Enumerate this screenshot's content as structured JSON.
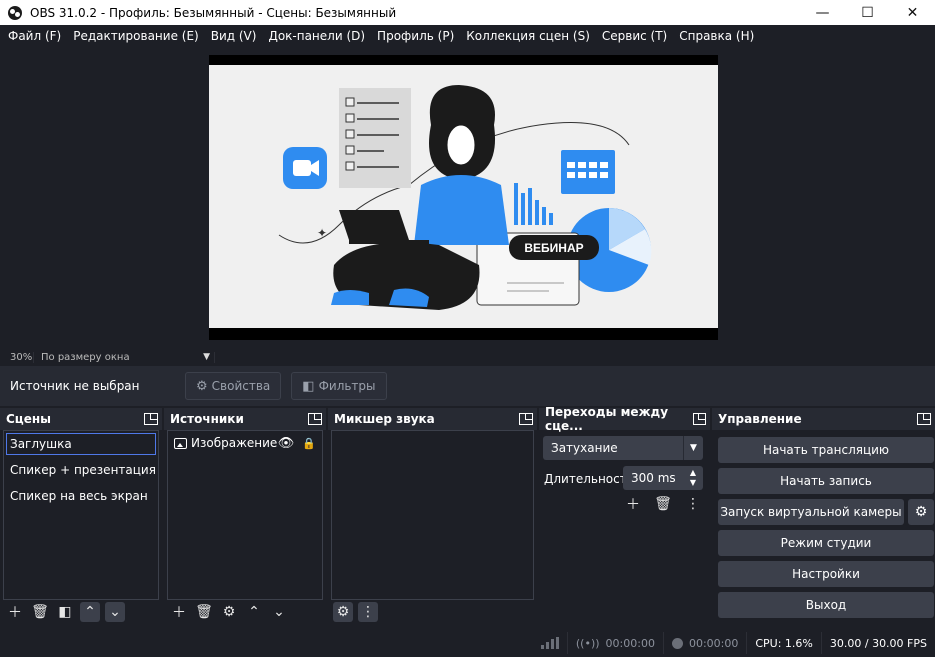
{
  "window": {
    "title": "OBS 31.0.2 - Профиль: Безымянный - Сцены: Безымянный",
    "minimize": "—",
    "maximize": "☐",
    "close": "✕"
  },
  "menu": [
    "Файл (F)",
    "Редактирование (E)",
    "Вид (V)",
    "Док-панели (D)",
    "Профиль (P)",
    "Коллекция сцен (S)",
    "Сервис (T)",
    "Справка (H)"
  ],
  "preview": {
    "zoom": "30%",
    "scale_mode": "По размеру окна",
    "slide_badge": "ВЕБИНАР"
  },
  "source_toolbar": {
    "no_source": "Источник не выбран",
    "properties": "Свойства",
    "filters": "Фильтры"
  },
  "scenes": {
    "title": "Сцены",
    "items": [
      "Заглушка",
      "Спикер + презентация",
      "Спикер на весь экран"
    ],
    "selected_index": 0
  },
  "sources": {
    "title": "Источники",
    "items": [
      {
        "name": "Изображение",
        "icon": "image-icon",
        "visible": true,
        "locked": true
      }
    ]
  },
  "mixer": {
    "title": "Микшер звука"
  },
  "transitions": {
    "title": "Переходы между сце...",
    "selected": "Затухание",
    "duration_label": "Длительность",
    "duration_value": "300 ms"
  },
  "controls": {
    "title": "Управление",
    "start_stream": "Начать трансляцию",
    "start_record": "Начать запись",
    "virtual_camera": "Запуск виртуальной камеры",
    "studio_mode": "Режим студии",
    "settings": "Настройки",
    "exit": "Выход"
  },
  "status": {
    "stream_time": "00:00:00",
    "record_time": "00:00:00",
    "cpu": "CPU: 1.6%",
    "fps": "30.00 / 30.00 FPS"
  },
  "colors": {
    "background": "#1d1f26",
    "panel": "#272a33",
    "button": "#3c404b",
    "selection": "#4f78e8",
    "illustration_blue": "#2f8cf0"
  }
}
